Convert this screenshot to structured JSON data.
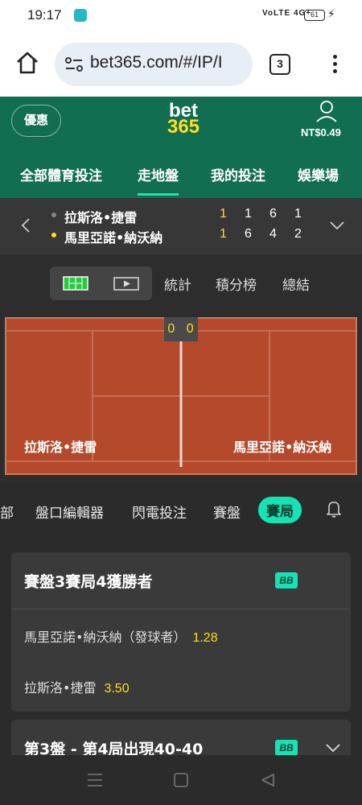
{
  "status_bar": {
    "time": "19:17",
    "signal": "VoLTE 4G+",
    "battery": "61"
  },
  "browser": {
    "url": "bet365.com/#/IP/I",
    "tab_count": "3"
  },
  "header": {
    "promo_label": "優惠",
    "logo_top": "bet",
    "logo_bottom": "365",
    "balance": "NT$0.49",
    "nav": [
      "全部體育投注",
      "走地盤",
      "我的投注",
      "娛樂場"
    ],
    "active_nav": "走地盤"
  },
  "match": {
    "players": [
      {
        "name": "拉斯洛•捷雷",
        "serving": false,
        "scores": [
          "1",
          "1",
          "6",
          "1"
        ]
      },
      {
        "name": "馬里亞諾•納沃納",
        "serving": true,
        "scores": [
          "1",
          "6",
          "4",
          "2"
        ]
      }
    ]
  },
  "media_tabs": [
    "統計",
    "積分榜",
    "總結"
  ],
  "court": {
    "score": "0 0",
    "left_player": "拉斯洛•捷雷",
    "right_player": "馬里亞諾•納沃納"
  },
  "market_tabs": [
    "部",
    "盤口編輯器",
    "閃電投注",
    "賽盤",
    "賽局"
  ],
  "active_market_tab": "賽局",
  "markets": [
    {
      "title": "賽盤3賽局4獲勝者",
      "badge": "BB",
      "selections": [
        {
          "label": "馬里亞諾•納沃納（發球者）",
          "odds": "1.28"
        },
        {
          "label": "拉斯洛•捷雷",
          "odds": "3.50"
        }
      ]
    },
    {
      "title": "第3盤 - 第4局出現40-40",
      "badge": "BB"
    }
  ],
  "colors": {
    "header_green": "#126e51",
    "accent": "#14e4b4",
    "odds_yellow": "#ffdf1b",
    "clay": "#b5492c"
  }
}
